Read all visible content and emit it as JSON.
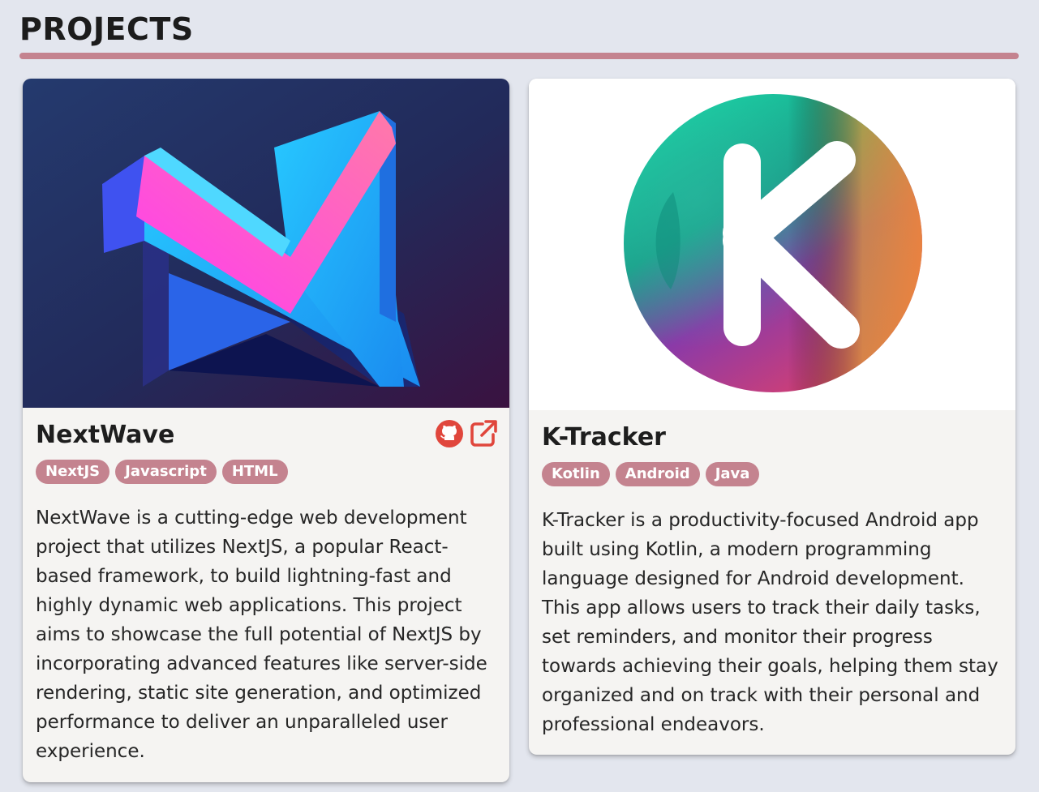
{
  "section": {
    "title": "PROJECTS"
  },
  "colors": {
    "accent": "#c4838f",
    "link_icon": "#e0463c",
    "background": "#e3e6ee",
    "card": "#f5f4f2"
  },
  "projects": [
    {
      "name": "NextWave",
      "image": "nextwave-logo",
      "tags": [
        "NextJS",
        "Javascript",
        "HTML"
      ],
      "links": [
        "github-icon",
        "external-link-icon"
      ],
      "description": "NextWave is a cutting-edge web development project that utilizes NextJS, a popular React-based framework, to build lightning-fast and highly dynamic web applications. This project aims to showcase the full potential of NextJS by incorporating advanced features like server-side rendering, static site generation, and optimized performance to deliver an unparalleled user experience."
    },
    {
      "name": "K-Tracker",
      "image": "k-tracker-logo",
      "tags": [
        "Kotlin",
        "Android",
        "Java"
      ],
      "description": "K-Tracker is a productivity-focused Android app built using Kotlin, a modern programming language designed for Android development. This app allows users to track their daily tasks, set reminders, and monitor their progress towards achieving their goals, helping them stay organized and on track with their personal and professional endeavors."
    }
  ]
}
